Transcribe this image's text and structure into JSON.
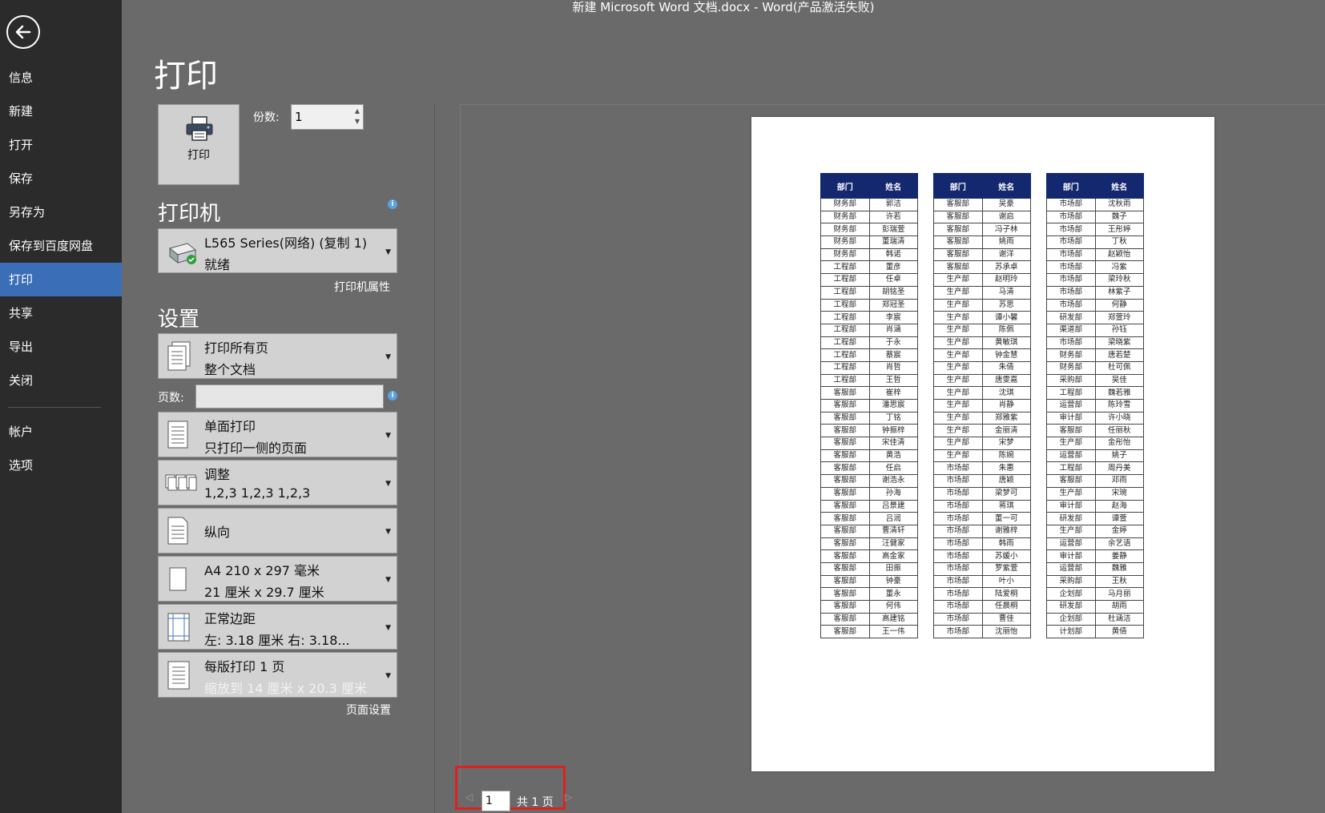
{
  "window": {
    "title": "新建 Microsoft Word 文档.docx - Word(产品激活失败)"
  },
  "sidebar": {
    "items": [
      {
        "label": "信息"
      },
      {
        "label": "新建"
      },
      {
        "label": "打开"
      },
      {
        "label": "保存"
      },
      {
        "label": "另存为"
      },
      {
        "label": "保存到百度网盘"
      },
      {
        "label": "打印",
        "active": true
      },
      {
        "label": "共享"
      },
      {
        "label": "导出"
      },
      {
        "label": "关闭"
      },
      {
        "label": "帐户"
      },
      {
        "label": "选项"
      }
    ]
  },
  "main": {
    "title": "打印",
    "print_button_label": "打印",
    "copies_label": "份数:",
    "copies_value": "1",
    "printer_heading": "打印机",
    "printer_name": "L565 Series(网络) (复制 1)",
    "printer_status": "就绪",
    "printer_properties": "打印机属性",
    "settings_heading": "设置",
    "pages_label": "页数:",
    "pages_value": "",
    "page_setup": "页面设置",
    "settings": [
      {
        "line1": "打印所有页",
        "line2": "整个文档",
        "icon": "pages-icon"
      },
      {
        "line1": "单面打印",
        "line2": "只打印一侧的页面",
        "icon": "one-sided-icon"
      },
      {
        "line1": "调整",
        "line2": "1,2,3    1,2,3    1,2,3",
        "icon": "collate-icon"
      },
      {
        "line1": "纵向",
        "line2": "",
        "icon": "portrait-icon"
      },
      {
        "line1": "A4 210 x 297 毫米",
        "line2": "21 厘米 x 29.7 厘米",
        "icon": "paper-size-icon"
      },
      {
        "line1": "正常边距",
        "line2": "左: 3.18 厘米    右: 3.18...",
        "icon": "margins-icon"
      },
      {
        "line1": "每版打印 1 页",
        "line2": "缩放到 14 厘米 x 20.3 厘米",
        "icon": "pages-per-sheet-icon"
      }
    ]
  },
  "preview": {
    "headers": [
      "部门",
      "姓名"
    ],
    "tables": [
      [
        [
          "财务部",
          "郭洁"
        ],
        [
          "财务部",
          "许若"
        ],
        [
          "财务部",
          "彭瑞萱"
        ],
        [
          "财务部",
          "董瑞清"
        ],
        [
          "财务部",
          "韩诺"
        ],
        [
          "工程部",
          "董彦"
        ],
        [
          "工程部",
          "任卓"
        ],
        [
          "工程部",
          "胡铭圣"
        ],
        [
          "工程部",
          "郑冠圣"
        ],
        [
          "工程部",
          "李宸"
        ],
        [
          "工程部",
          "肖涵"
        ],
        [
          "工程部",
          "于永"
        ],
        [
          "工程部",
          "蔡宸"
        ],
        [
          "工程部",
          "肖哲"
        ],
        [
          "工程部",
          "王哲"
        ],
        [
          "客服部",
          "崔梓"
        ],
        [
          "客服部",
          "潘思宸"
        ],
        [
          "客服部",
          "丁铭"
        ],
        [
          "客服部",
          "钟振梓"
        ],
        [
          "客服部",
          "宋佳清"
        ],
        [
          "客服部",
          "黄浩"
        ],
        [
          "客服部",
          "任启"
        ],
        [
          "客服部",
          "谢浩永"
        ],
        [
          "客服部",
          "孙海"
        ],
        [
          "客服部",
          "吕景建"
        ],
        [
          "客服部",
          "吕润"
        ],
        [
          "客服部",
          "曹清轩"
        ],
        [
          "客服部",
          "汪健家"
        ],
        [
          "客服部",
          "高金家"
        ],
        [
          "客服部",
          "田振"
        ],
        [
          "客服部",
          "钟豪"
        ],
        [
          "客服部",
          "董永"
        ],
        [
          "客服部",
          "何伟"
        ],
        [
          "客服部",
          "高建铭"
        ],
        [
          "客服部",
          "王一伟"
        ]
      ],
      [
        [
          "客服部",
          "吴豪"
        ],
        [
          "客服部",
          "谢启"
        ],
        [
          "客服部",
          "冯子林"
        ],
        [
          "客服部",
          "姚雨"
        ],
        [
          "客服部",
          "谢洋"
        ],
        [
          "客服部",
          "苏承卓"
        ],
        [
          "生产部",
          "赵明玲"
        ],
        [
          "生产部",
          "马清"
        ],
        [
          "生产部",
          "苏思"
        ],
        [
          "生产部",
          "谭小馨"
        ],
        [
          "生产部",
          "陈佩"
        ],
        [
          "生产部",
          "黄敏琪"
        ],
        [
          "生产部",
          "钟金慧"
        ],
        [
          "生产部",
          "朱倩"
        ],
        [
          "生产部",
          "唐雯嘉"
        ],
        [
          "生产部",
          "沈琪"
        ],
        [
          "生产部",
          "肖静"
        ],
        [
          "生产部",
          "郑雅紫"
        ],
        [
          "生产部",
          "金丽清"
        ],
        [
          "生产部",
          "宋梦"
        ],
        [
          "生产部",
          "陈婉"
        ],
        [
          "市场部",
          "朱惠"
        ],
        [
          "市场部",
          "唐颖"
        ],
        [
          "市场部",
          "梁梦可"
        ],
        [
          "市场部",
          "蒋琪"
        ],
        [
          "市场部",
          "董一可"
        ],
        [
          "市场部",
          "谢雅梓"
        ],
        [
          "市场部",
          "韩雨"
        ],
        [
          "市场部",
          "苏媛小"
        ],
        [
          "市场部",
          "罗紫萱"
        ],
        [
          "市场部",
          "叶小"
        ],
        [
          "市场部",
          "陆爱桐"
        ],
        [
          "市场部",
          "任晨桐"
        ],
        [
          "市场部",
          "曹佳"
        ],
        [
          "市场部",
          "沈丽怡"
        ]
      ],
      [
        [
          "市场部",
          "沈秋雨"
        ],
        [
          "市场部",
          "魏子"
        ],
        [
          "市场部",
          "王彤婷"
        ],
        [
          "市场部",
          "丁秋"
        ],
        [
          "市场部",
          "赵颖怡"
        ],
        [
          "市场部",
          "冯紫"
        ],
        [
          "市场部",
          "梁玲秋"
        ],
        [
          "市场部",
          "林紫子"
        ],
        [
          "市场部",
          "何静"
        ],
        [
          "研发部",
          "郑萱玲"
        ],
        [
          "渠道部",
          "孙钰"
        ],
        [
          "市场部",
          "梁晓紫"
        ],
        [
          "财务部",
          "唐若楚"
        ],
        [
          "财务部",
          "杜可佩"
        ],
        [
          "采购部",
          "吴佳"
        ],
        [
          "工程部",
          "魏若雅"
        ],
        [
          "运营部",
          "陈玲雪"
        ],
        [
          "审计部",
          "许小晓"
        ],
        [
          "客服部",
          "任丽秋"
        ],
        [
          "生产部",
          "金彤怡"
        ],
        [
          "运营部",
          "姚子"
        ],
        [
          "工程部",
          "周丹美"
        ],
        [
          "客服部",
          "邓雨"
        ],
        [
          "生产部",
          "宋琬"
        ],
        [
          "审计部",
          "赵海"
        ],
        [
          "研发部",
          "谭萱"
        ],
        [
          "生产部",
          "金婷"
        ],
        [
          "运营部",
          "余艺语"
        ],
        [
          "审计部",
          "姜静"
        ],
        [
          "运营部",
          "魏雅"
        ],
        [
          "采购部",
          "王秋"
        ],
        [
          "企划部",
          "马月丽"
        ],
        [
          "研发部",
          "胡雨"
        ],
        [
          "企划部",
          "杜涵洁"
        ],
        [
          "计划部",
          "黄倩"
        ]
      ]
    ]
  },
  "page_nav": {
    "current": "1",
    "total": "共 1 页"
  }
}
